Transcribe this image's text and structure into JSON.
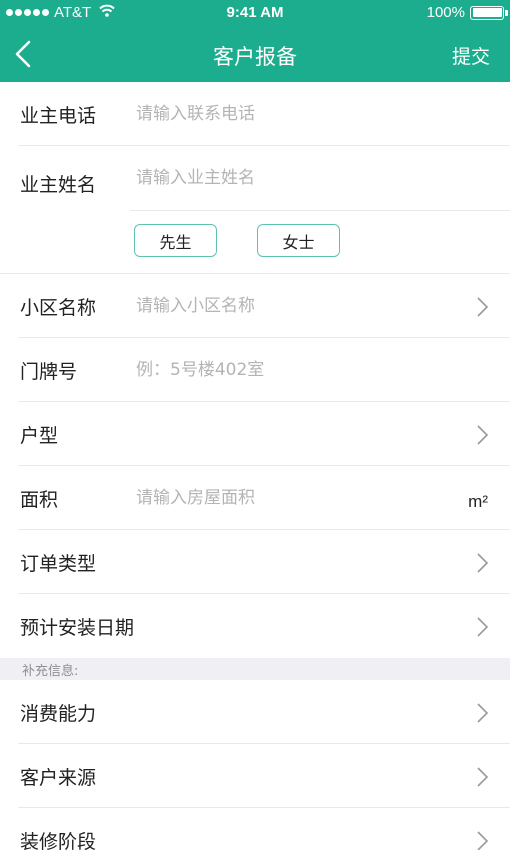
{
  "status_bar": {
    "carrier": "AT&T",
    "time": "9:41 AM",
    "battery_percent": "100%",
    "battery_level": 1.0,
    "signal_bars": 5
  },
  "nav": {
    "title": "客户报备",
    "submit_label": "提交",
    "back_icon": "chevron-left-icon"
  },
  "form": {
    "owner_phone": {
      "label": "业主电话",
      "placeholder": "请输入联系电话"
    },
    "owner_name": {
      "label": "业主姓名",
      "placeholder": "请输入业主姓名"
    },
    "gender": {
      "male": "先生",
      "female": "女士"
    },
    "community": {
      "label": "小区名称",
      "placeholder": "请输入小区名称"
    },
    "door_number": {
      "label": "门牌号",
      "placeholder": "例：5号楼402室"
    },
    "house_type": {
      "label": "户型"
    },
    "area": {
      "label": "面积",
      "placeholder": "请输入房屋面积",
      "unit": "m²"
    },
    "order_type": {
      "label": "订单类型"
    },
    "install_date": {
      "label": "预计安装日期"
    }
  },
  "supplement": {
    "header": "补充信息:",
    "items": [
      {
        "label": "消费能力"
      },
      {
        "label": "客户来源"
      },
      {
        "label": "装修阶段"
      }
    ]
  },
  "colors": {
    "brand": "#1cac8e",
    "button_border": "#5cc2ae",
    "placeholder": "#b4b4b4",
    "section_bg": "#efeff4"
  }
}
